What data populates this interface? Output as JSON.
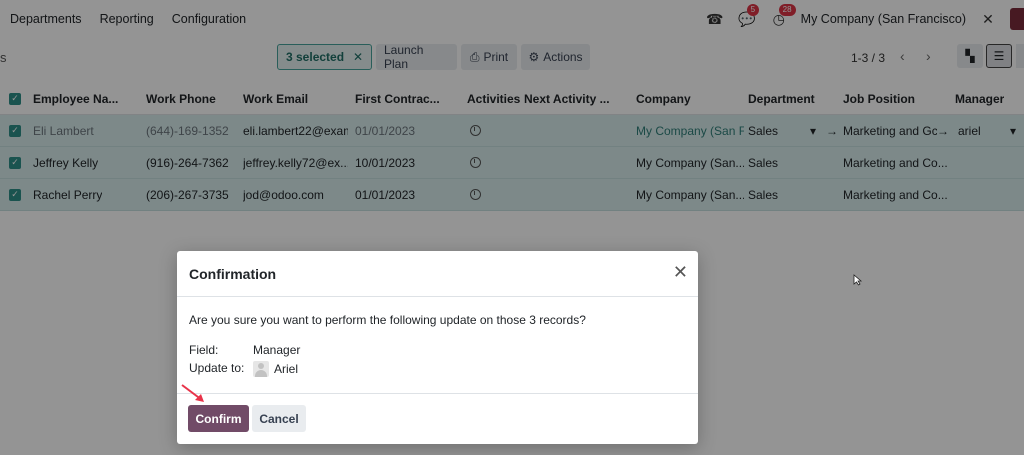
{
  "nav": {
    "menu": [
      "Departments",
      "Reporting",
      "Configuration"
    ],
    "messages_count": "5",
    "activities_count": "28",
    "company": "My Company (San Francisco)"
  },
  "control": {
    "breadcrumb_fragment": "s",
    "selected_label": "3 selected",
    "launch_plan": "Launch Plan",
    "print": "Print",
    "actions": "Actions",
    "pager": "1-3 / 3"
  },
  "table": {
    "headers": [
      "Employee Na...",
      "Work Phone",
      "Work Email",
      "First Contrac...",
      "Activities",
      "Next Activity ...",
      "Company",
      "Department",
      "Job Position",
      "Manager"
    ],
    "rows": [
      {
        "name": "Eli Lambert",
        "phone": "(644)-169-1352",
        "email": "eli.lambert22@exam",
        "contract": "01/01/2023",
        "company": "My Company (San Fr",
        "department": "Sales",
        "job": "Marketing and Gc",
        "manager": "ariel"
      },
      {
        "name": "Jeffrey Kelly",
        "phone": "(916)-264-7362",
        "email": "jeffrey.kelly72@ex...",
        "contract": "10/01/2023",
        "company": "My Company (San...",
        "department": "Sales",
        "job": "Marketing and Co...",
        "manager": ""
      },
      {
        "name": "Rachel Perry",
        "phone": "(206)-267-3735",
        "email": "jod@odoo.com",
        "contract": "01/01/2023",
        "company": "My Company (San...",
        "department": "Sales",
        "job": "Marketing and Co...",
        "manager": ""
      }
    ]
  },
  "modal": {
    "title": "Confirmation",
    "question": "Are you sure you want to perform the following update on those 3 records?",
    "field_label": "Field:",
    "field_value": "Manager",
    "update_label": "Update to:",
    "update_value": "Ariel",
    "confirm": "Confirm",
    "cancel": "Cancel"
  },
  "colors": {
    "primary": "#714b67",
    "selected_row": "#d7ecec",
    "checkbox": "#2d8f88",
    "annotation_arrow": "#e8334a"
  }
}
